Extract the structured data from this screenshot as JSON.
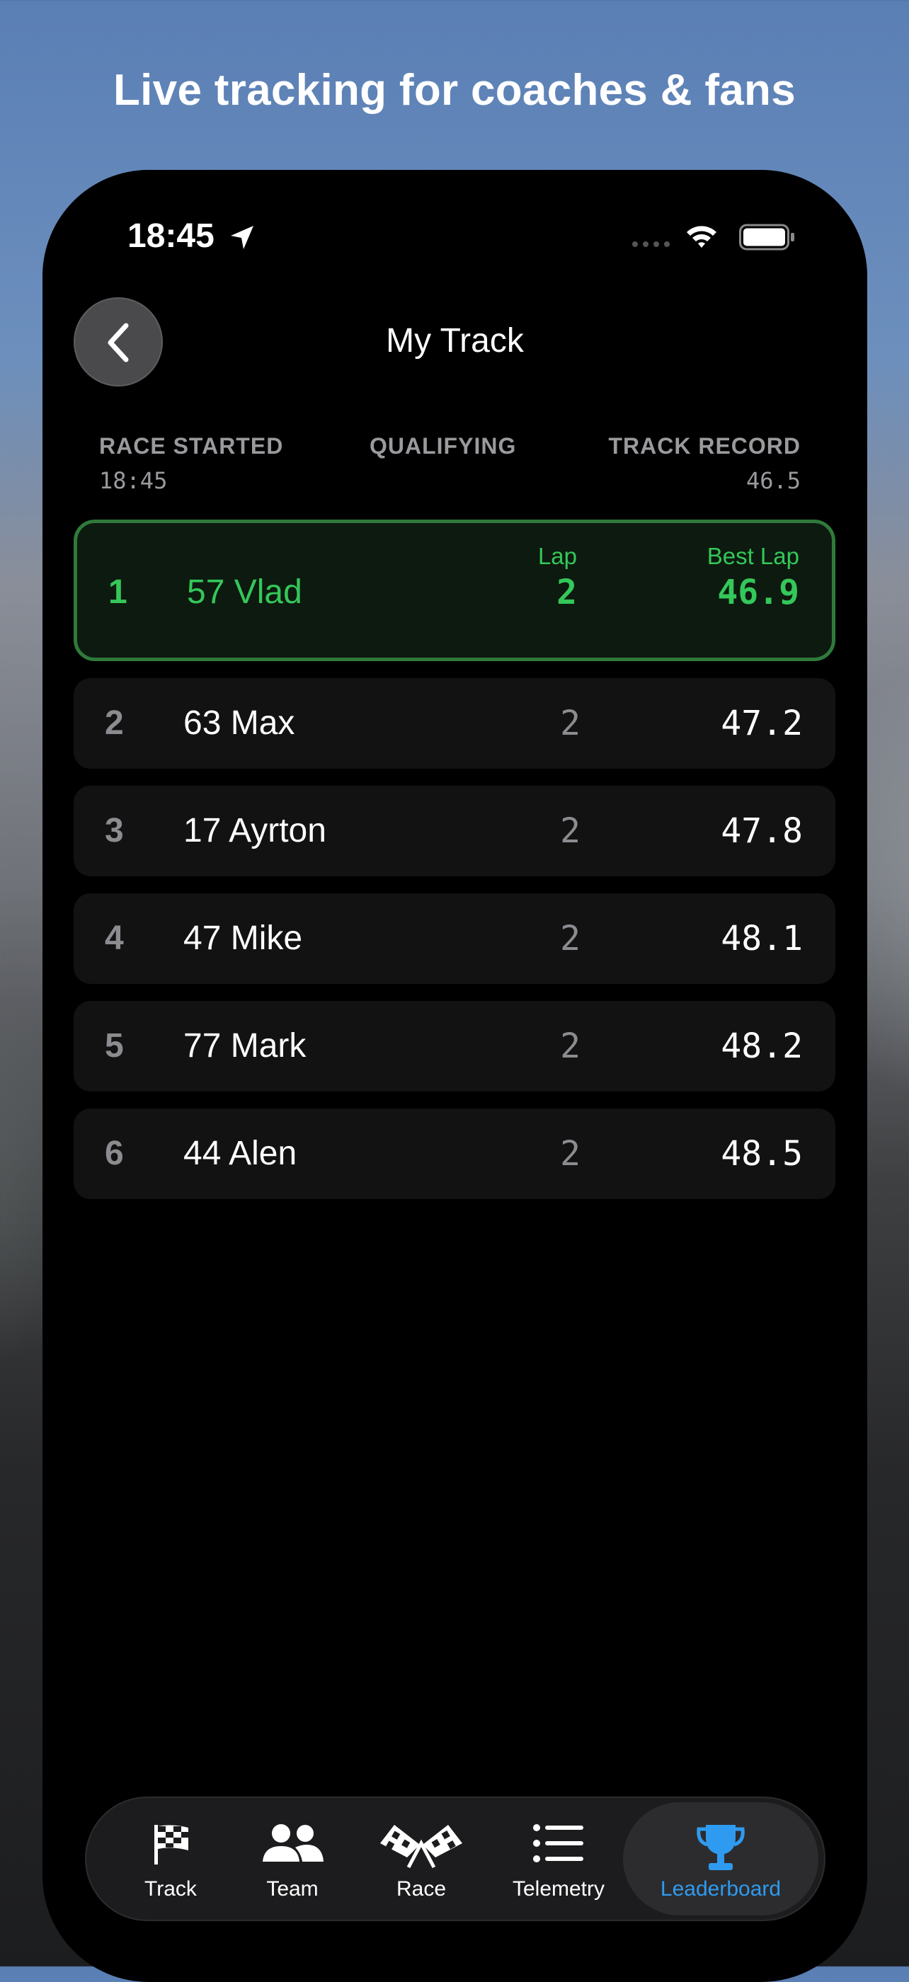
{
  "headline": "Live tracking for coaches & fans",
  "status": {
    "time": "18:45"
  },
  "nav": {
    "title": "My Track"
  },
  "meta": {
    "race_started_label": "RACE STARTED",
    "race_started_value": "18:45",
    "session": "QUALIFYING",
    "track_record_label": "TRACK RECORD",
    "track_record_value": "46.5"
  },
  "leaderboard": {
    "lap_header": "Lap",
    "best_lap_header": "Best Lap",
    "rows": [
      {
        "pos": "1",
        "name": "57 Vlad",
        "lap": "2",
        "best": "46.9"
      },
      {
        "pos": "2",
        "name": "63 Max",
        "lap": "2",
        "best": "47.2"
      },
      {
        "pos": "3",
        "name": "17 Ayrton",
        "lap": "2",
        "best": "47.8"
      },
      {
        "pos": "4",
        "name": "47 Mike",
        "lap": "2",
        "best": "48.1"
      },
      {
        "pos": "5",
        "name": "77 Mark",
        "lap": "2",
        "best": "48.2"
      },
      {
        "pos": "6",
        "name": "44 Alen",
        "lap": "2",
        "best": "48.5"
      }
    ]
  },
  "tabs": [
    {
      "label": "Track",
      "icon": "checkered-flag-icon"
    },
    {
      "label": "Team",
      "icon": "team-icon"
    },
    {
      "label": "Race",
      "icon": "crossed-flags-icon"
    },
    {
      "label": "Telemetry",
      "icon": "list-icon"
    },
    {
      "label": "Leaderboard",
      "icon": "trophy-icon",
      "active": true
    }
  ],
  "colors": {
    "leader_green": "#34c759",
    "active_tab_blue": "#2e9bf0"
  }
}
